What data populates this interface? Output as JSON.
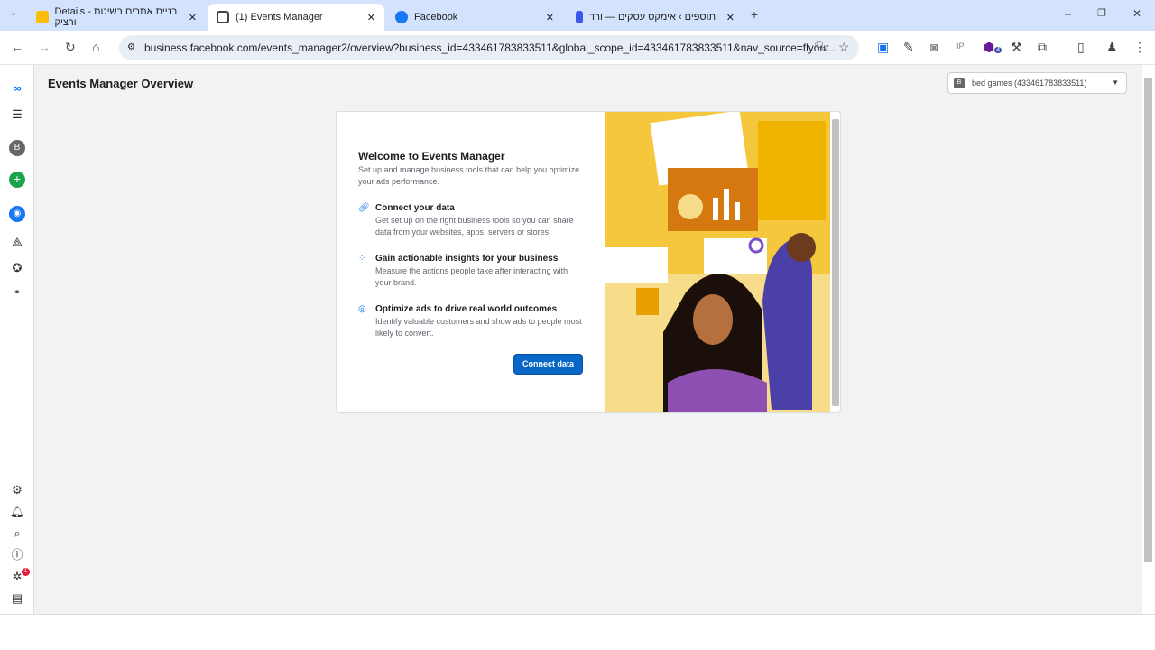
{
  "browser": {
    "tabs": [
      {
        "title": "Details - בניית אתרים בשיטת ורציק"
      },
      {
        "title": "(1) Events Manager"
      },
      {
        "title": "Facebook"
      },
      {
        "title": "תוספים › אימקס עסקים — ורד"
      }
    ],
    "url": "business.facebook.com/events_manager2/overview?business_id=433461783833511&global_scope_id=433461783833511&nav_source=flyout...",
    "extension_badge": "4"
  },
  "sidebar": {
    "avatar_letter": "B",
    "notification_count": "1"
  },
  "header": {
    "title": "Events Manager Overview",
    "account": "bed games (433461783833511)",
    "account_letter": "B"
  },
  "card": {
    "title": "Welcome to Events Manager",
    "subtitle": "Set up and manage business tools that can help you optimize your ads performance.",
    "items": [
      {
        "title": "Connect your data",
        "desc": "Get set up on the right business tools so you can share data from your websites, apps, servers or stores."
      },
      {
        "title": "Gain actionable insights for your business",
        "desc": "Measure the actions people take after interacting with your brand."
      },
      {
        "title": "Optimize ads to drive real world outcomes",
        "desc": "Identify valuable customers and show ads to people most likely to convert."
      }
    ],
    "button": "Connect data"
  }
}
